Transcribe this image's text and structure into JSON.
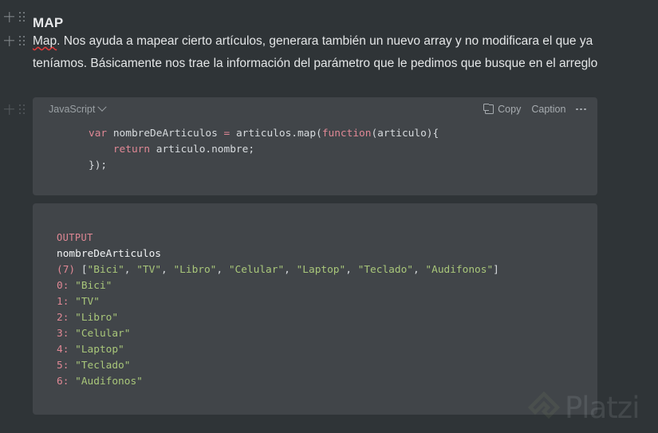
{
  "heading": {
    "title": "MAP"
  },
  "paragraph": {
    "misspelled_word": "Map",
    "text_rest": ". Nos ayuda a mapear cierto artículos, generara también un nuevo array y no modificara el que ya teníamos. Básicamente nos trae la información del parámetro que le pedimos que busque en el arreglo"
  },
  "code_block": {
    "language": "JavaScript",
    "copy_label": "Copy",
    "caption_label": "Caption",
    "more_label": "...",
    "lines": {
      "l1_kw": "var",
      "l1_mid": " nombreDeArticulos ",
      "l1_op": "=",
      "l1_call": " articulos.map(",
      "l1_fn": "function",
      "l1_tail": "(articulo){",
      "l2_kw": "return",
      "l2_rest": " articulo.nombre;",
      "l3": "});"
    }
  },
  "output_block": {
    "label": "OUTPUT",
    "variable": "nombreDeArticulos",
    "count": "(7)",
    "array_items": [
      "Bici",
      "TV",
      "Libro",
      "Celular",
      "Laptop",
      "Teclado",
      "Audifonos"
    ],
    "indexed": [
      {
        "index": "0:",
        "value": "\"Bici\""
      },
      {
        "index": "1:",
        "value": "\"TV\""
      },
      {
        "index": "2:",
        "value": "\"Libro\""
      },
      {
        "index": "3:",
        "value": "\"Celular\""
      },
      {
        "index": "4:",
        "value": "\"Laptop\""
      },
      {
        "index": "5:",
        "value": "\"Teclado\""
      },
      {
        "index": "6:",
        "value": "\"Audifonos\""
      }
    ]
  },
  "watermark": {
    "text": "Platzi"
  },
  "colors": {
    "page_background": "#2f3437",
    "block_background": "#414549",
    "keyword": "#e08895",
    "string": "#a9c77a",
    "text": "#e4e6e7",
    "spellcheck_underline": "#e03b3b"
  }
}
